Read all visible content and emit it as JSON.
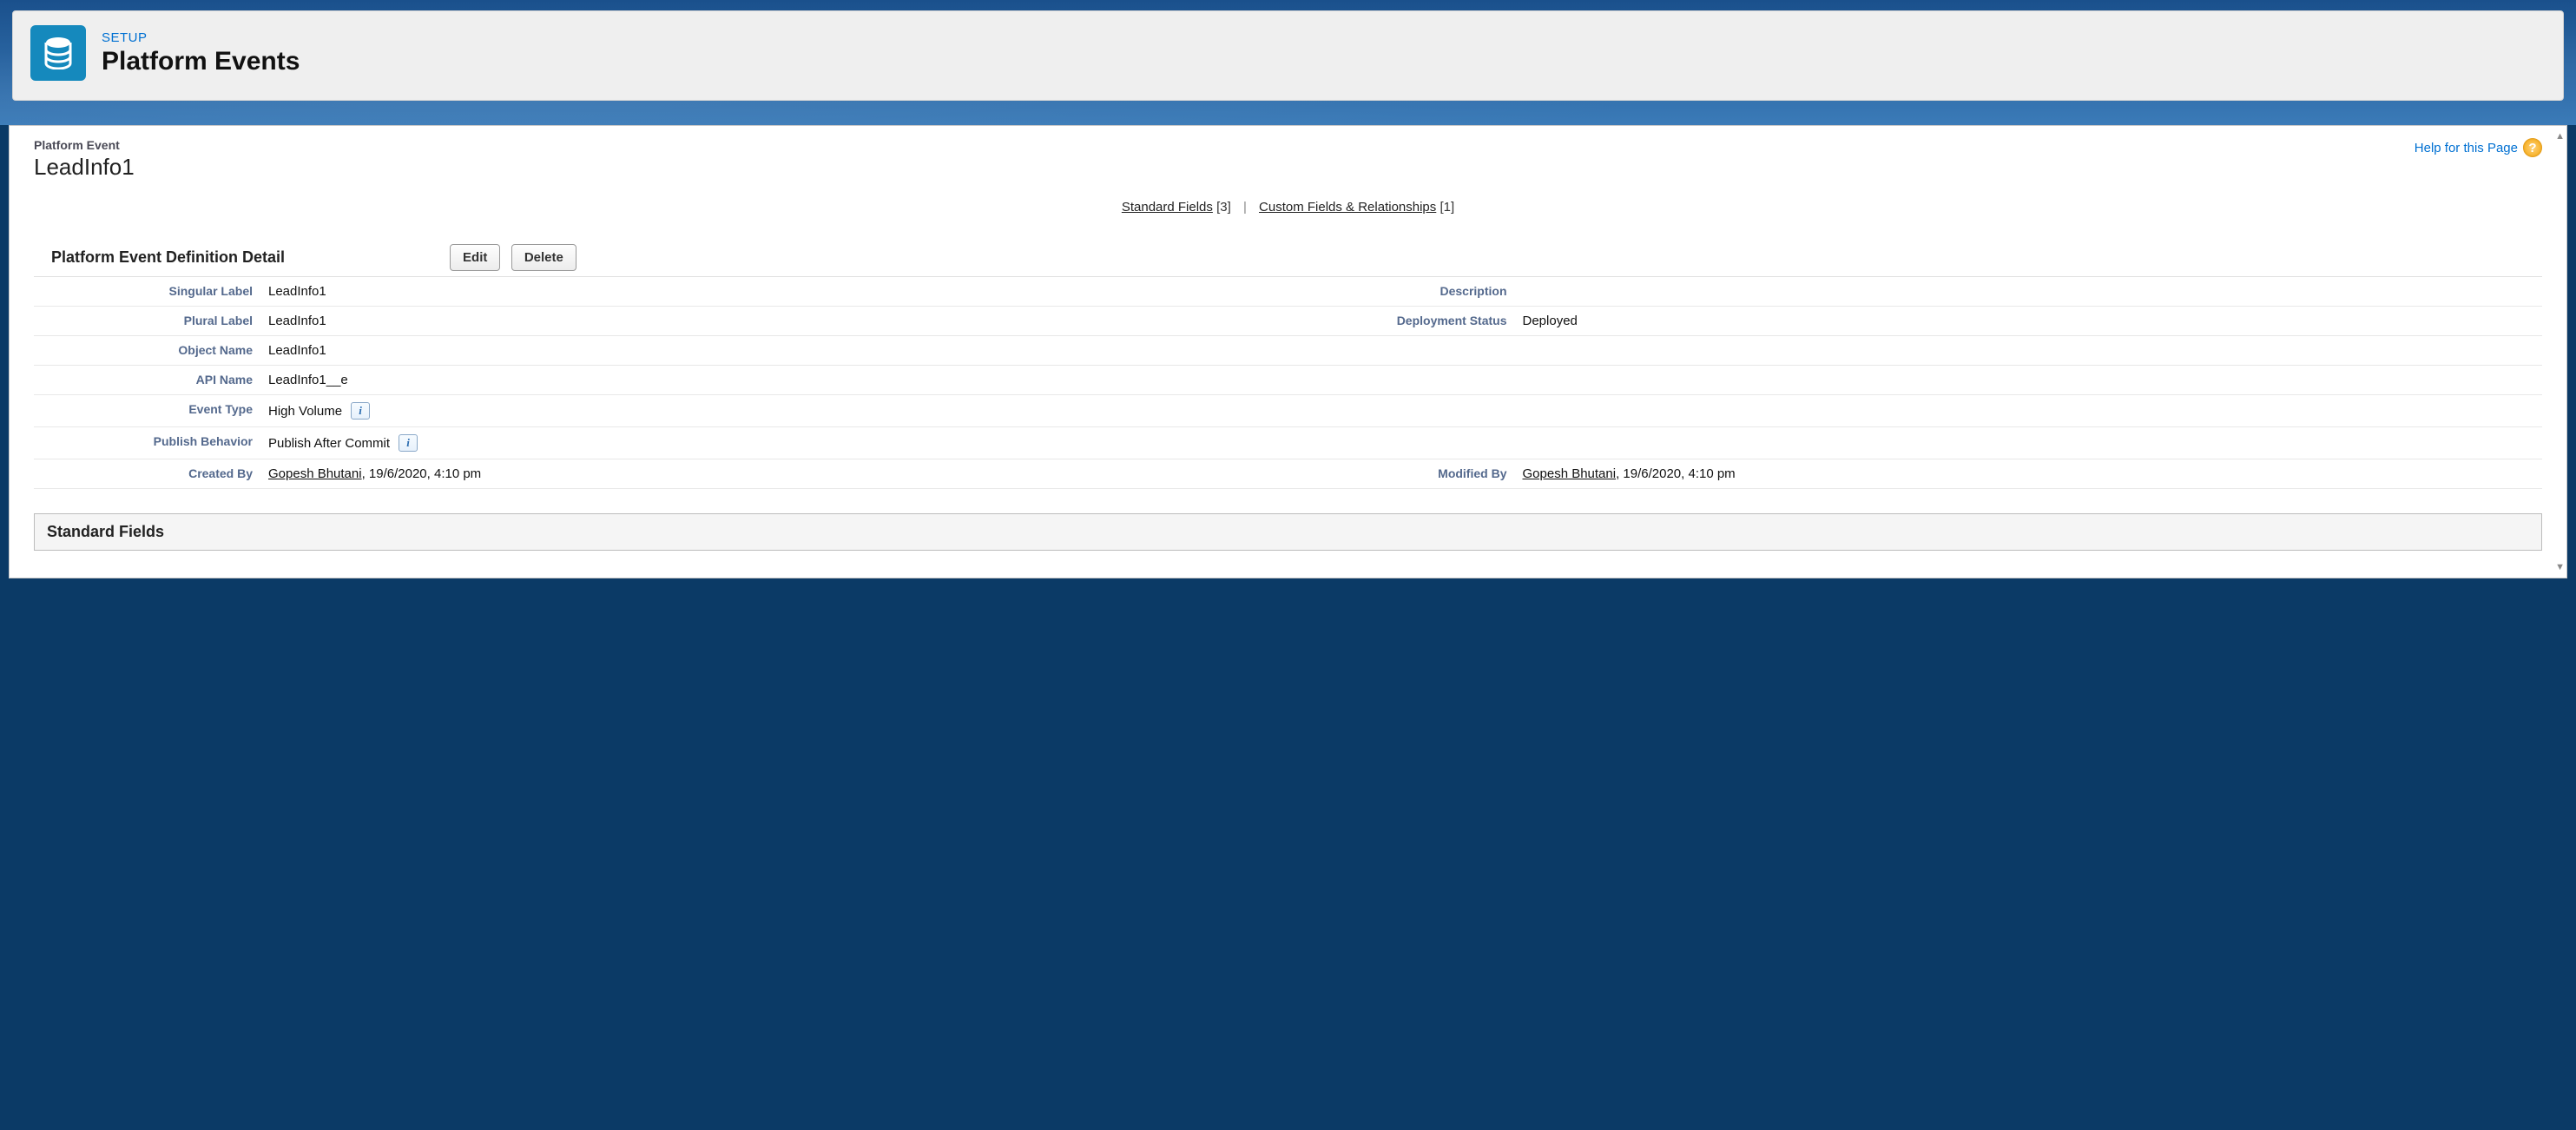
{
  "header": {
    "eyebrow": "SETUP",
    "title": "Platform Events"
  },
  "page": {
    "object_eyebrow": "Platform Event",
    "object_name": "LeadInfo1",
    "help_label": "Help for this Page"
  },
  "anchors": {
    "standard_fields_label": "Standard Fields",
    "standard_fields_count": "[3]",
    "custom_fields_label": "Custom Fields & Relationships",
    "custom_fields_count": "[1]"
  },
  "detail_section": {
    "title": "Platform Event Definition Detail",
    "edit_label": "Edit",
    "delete_label": "Delete"
  },
  "labels": {
    "singular_label": "Singular Label",
    "plural_label": "Plural Label",
    "object_name": "Object Name",
    "api_name": "API Name",
    "event_type": "Event Type",
    "publish_behavior": "Publish Behavior",
    "created_by": "Created By",
    "description": "Description",
    "deployment_status": "Deployment Status",
    "modified_by": "Modified By"
  },
  "values": {
    "singular_label": "LeadInfo1",
    "plural_label": "LeadInfo1",
    "object_name": "LeadInfo1",
    "api_name": "LeadInfo1__e",
    "event_type": "High Volume",
    "publish_behavior": "Publish After Commit",
    "description": "",
    "deployment_status": "Deployed",
    "created_by_name": "Gopesh Bhutani",
    "created_by_date": ", 19/6/2020, 4:10 pm",
    "modified_by_name": "Gopesh Bhutani",
    "modified_by_date": ", 19/6/2020, 4:10 pm"
  },
  "sections": {
    "standard_fields": "Standard Fields"
  }
}
